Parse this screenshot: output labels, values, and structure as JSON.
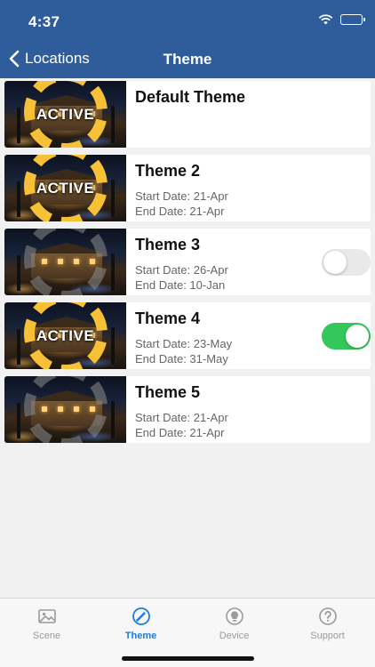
{
  "status": {
    "time": "4:37"
  },
  "nav": {
    "back_label": "Locations",
    "title": "Theme"
  },
  "themes": [
    {
      "name": "Default Theme",
      "active": true,
      "active_label": "ACTIVE",
      "start": "",
      "end": "",
      "toggle": null
    },
    {
      "name": "Theme 2",
      "active": true,
      "active_label": "ACTIVE",
      "start": "Start Date: 21-Apr",
      "end": "End Date: 21-Apr",
      "toggle": null
    },
    {
      "name": "Theme 3",
      "active": false,
      "active_label": "",
      "start": "Start Date: 26-Apr",
      "end": "End Date: 10-Jan",
      "toggle": "off"
    },
    {
      "name": "Theme 4",
      "active": true,
      "active_label": "ACTIVE",
      "start": "Start Date: 23-May",
      "end": "End Date: 31-May",
      "toggle": "on"
    },
    {
      "name": "Theme 5",
      "active": false,
      "active_label": "",
      "start": "Start Date: 21-Apr",
      "end": "End Date: 21-Apr",
      "toggle": null
    }
  ],
  "tabbar": {
    "tabs": [
      {
        "label": "Scene",
        "icon": "image-icon"
      },
      {
        "label": "Theme",
        "icon": "brush-icon"
      },
      {
        "label": "Device",
        "icon": "bulb-icon"
      },
      {
        "label": "Support",
        "icon": "question-icon"
      }
    ],
    "selected": "Theme"
  },
  "colors": {
    "nav": "#2f5d9b",
    "accent": "#1a7de0",
    "toggle_on": "#34c759",
    "ring": "#f7c137"
  }
}
